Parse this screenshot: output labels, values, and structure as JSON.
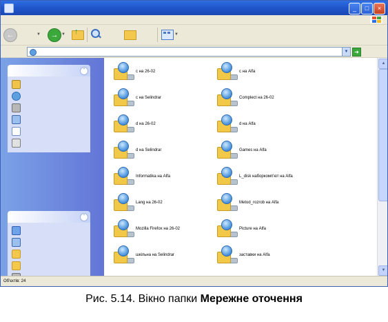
{
  "window": {
    "title": ""
  },
  "menu": {
    "items": [
      "",
      "",
      "",
      "",
      "",
      ""
    ]
  },
  "toolbar": {
    "back_label": "",
    "search_label": "",
    "folders_label": ""
  },
  "address": {
    "label": "",
    "value": "",
    "go_label": ""
  },
  "tasks_panel": {
    "title": "",
    "items": [
      {
        "icon": "house-icon",
        "label": ""
      },
      {
        "icon": "network-icon",
        "label": ""
      },
      {
        "icon": "printer-icon",
        "label": ""
      },
      {
        "icon": "network-setup-icon",
        "label": ""
      },
      {
        "icon": "workgroup-computers-icon",
        "label": ""
      },
      {
        "icon": "upnp-icon",
        "label": ""
      }
    ]
  },
  "places_panel": {
    "title": "",
    "items": [
      {
        "icon": "desktop-icon",
        "label": ""
      },
      {
        "icon": "my-computer-icon",
        "label": ""
      },
      {
        "icon": "my-documents-icon",
        "label": ""
      },
      {
        "icon": "shared-documents-icon",
        "label": ""
      },
      {
        "icon": "printers-icon",
        "label": ""
      }
    ]
  },
  "network_items": [
    {
      "label": "c на 26-02"
    },
    {
      "label": "c на Alfa"
    },
    {
      "label": "c на Selindrar"
    },
    {
      "label": "Complect на 26-02"
    },
    {
      "label": "d на 26-02"
    },
    {
      "label": "d на Alfa"
    },
    {
      "label": "d на Selindrar"
    },
    {
      "label": "Games на Alfa"
    },
    {
      "label": "Informatika на Alfa"
    },
    {
      "label": "L_disk наборкомп'ют на Alfa"
    },
    {
      "label": "Lang на 26-02"
    },
    {
      "label": "Metod_rozrob на Alfa"
    },
    {
      "label": "Mozilla Firefox на 26-02"
    },
    {
      "label": "Picture на Alfa"
    },
    {
      "label": "шкільна на Selindrar"
    },
    {
      "label": "заставки на Alfa"
    }
  ],
  "status": {
    "text": "Об'єктів: 24"
  },
  "caption": {
    "prefix": "Рис. 5.14. Вікно папки ",
    "bold": "Мережне оточення"
  },
  "colors": {
    "titlebar": "#2f6fe4",
    "taskpane": "#7ba2e7",
    "link": "#215dc6",
    "chrome": "#ece9d8"
  }
}
